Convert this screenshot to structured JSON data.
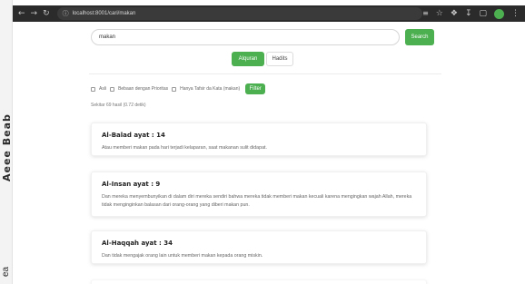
{
  "left_strip": {
    "text_top": "Aeee Beab",
    "text_bottom": "ea"
  },
  "browser": {
    "url": "localhost:8001/cari/makan",
    "icons": [
      "back-icon",
      "forward-icon",
      "reload-icon",
      "info-icon",
      "translate-icon",
      "star-icon",
      "extension-icon",
      "download-icon",
      "sidebar-icon",
      "profile-icon",
      "menu-icon"
    ]
  },
  "search": {
    "value": "makan",
    "button_label": "Search"
  },
  "tabs": [
    {
      "label": "Alquran",
      "active": true
    },
    {
      "label": "Hadits",
      "active": false
    }
  ],
  "filters": {
    "options": [
      "Asli",
      "Bebaan dengan Prioritas",
      "Hanya Tafsir da Kata (makan)"
    ],
    "button_label": "Filter"
  },
  "result_count": "Sekitar 69 hasil (0.72 detik)",
  "results": [
    {
      "title": "Al-Balad ayat : 14",
      "text": "Atau memberi makan pada hari terjadi kelaparan, saat makanan sulit didapat."
    },
    {
      "title": "Al-Insan ayat : 9",
      "text": "Dan mereka menyembunyikan di dalam diri mereka sendiri bahwa mereka tidak memberi makan kecuali karena mengingkan wajah Allah, mereka tidak menginginkan balasan dari orang-orang yang diberi makan pun."
    },
    {
      "title": "Al-Haqqah ayat : 34",
      "text": "Dan tidak mengajak orang lain untuk memberi makan kepada orang miskin."
    },
    {
      "title": "",
      "text": ""
    }
  ],
  "colors": {
    "accent": "#4caf50",
    "chrome": "#2b2b2b"
  }
}
